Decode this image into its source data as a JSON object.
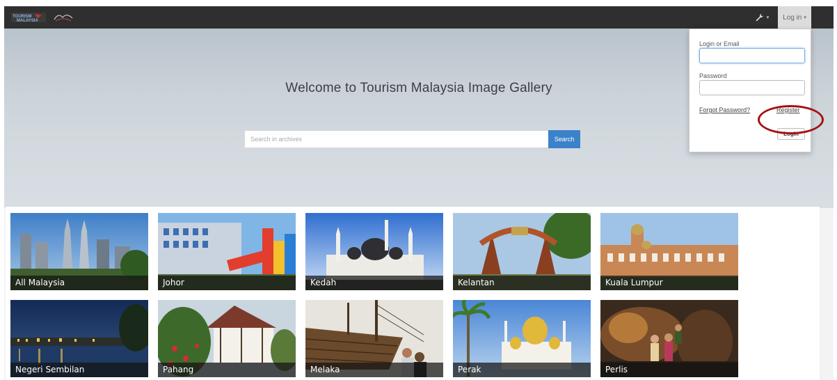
{
  "header": {
    "logo_primary": "Tourism Malaysia logo",
    "logo_secondary": "Malaysia Truly Asia logo",
    "tools_icon": "wrench-icon",
    "login_label": "Log in"
  },
  "hero": {
    "title": "Welcome to Tourism Malaysia Image Gallery",
    "search_placeholder": "Search in archives",
    "search_button": "Search"
  },
  "login_dropdown": {
    "login_label": "Login or Email",
    "login_value": "",
    "password_label": "Password",
    "password_value": "",
    "forgot_label": "Forgot Password?",
    "register_label": "Register",
    "submit_label": "Login"
  },
  "annotation": {
    "highlight_color": "#a51212"
  },
  "gallery": {
    "tiles": [
      {
        "label": "All Malaysia"
      },
      {
        "label": "Johor"
      },
      {
        "label": "Kedah"
      },
      {
        "label": "Kelantan"
      },
      {
        "label": "Kuala Lumpur"
      },
      {
        "label": "Negeri Sembilan"
      },
      {
        "label": "Pahang"
      },
      {
        "label": "Melaka"
      },
      {
        "label": "Perak"
      },
      {
        "label": "Perlis"
      }
    ]
  }
}
